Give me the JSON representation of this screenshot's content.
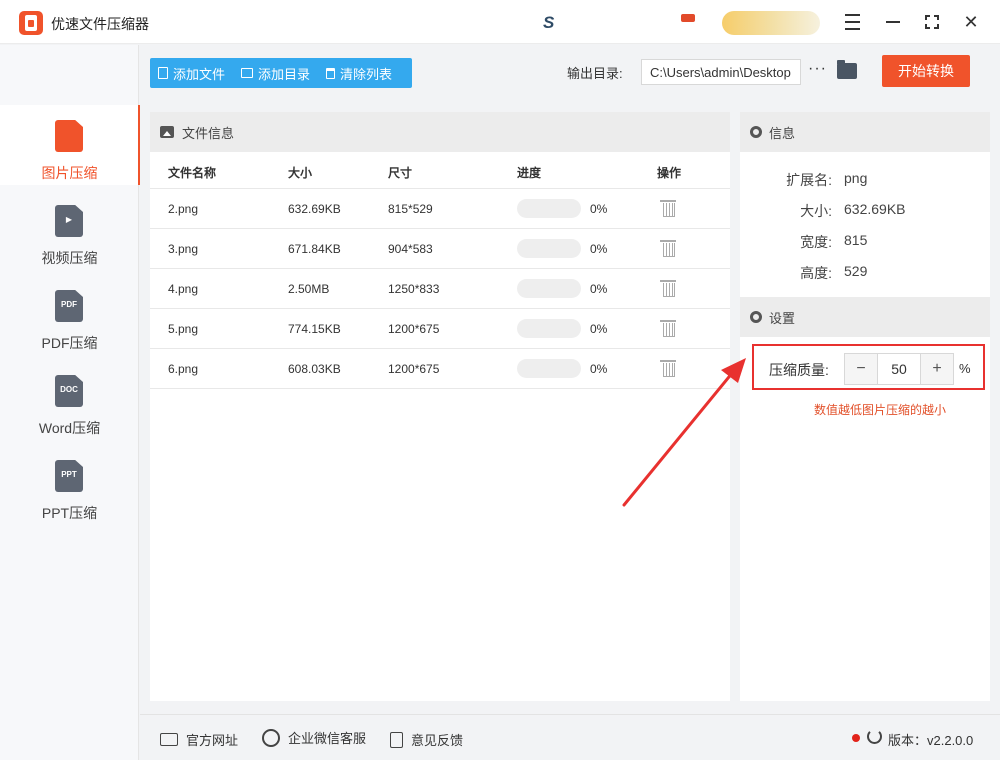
{
  "app": {
    "title": "优速文件压缩器"
  },
  "colors": {
    "accent": "#f0532b",
    "toolbar_blue": "#34a9ee",
    "hint_red": "#e2502a",
    "annotation_red": "#e8312f"
  },
  "sidebar": {
    "items": [
      {
        "label": "图片压缩",
        "icon": "image-file-icon",
        "icon_text": "",
        "active": true
      },
      {
        "label": "视频压缩",
        "icon": "video-file-icon",
        "icon_text": "▶",
        "active": false
      },
      {
        "label": "PDF压缩",
        "icon": "pdf-file-icon",
        "icon_text": "PDF",
        "active": false
      },
      {
        "label": "Word压缩",
        "icon": "doc-file-icon",
        "icon_text": "DOC",
        "active": false
      },
      {
        "label": "PPT压缩",
        "icon": "ppt-file-icon",
        "icon_text": "PPT",
        "active": false
      }
    ]
  },
  "toolbar": {
    "add_file": "添加文件",
    "add_dir": "添加目录",
    "clear_list": "清除列表",
    "output_label": "输出目录:",
    "output_path": "C:\\Users\\admin\\Desktop",
    "more": "···",
    "start": "开始转换"
  },
  "file_panel": {
    "title": "文件信息",
    "columns": {
      "name": "文件名称",
      "size": "大小",
      "dims": "尺寸",
      "progress": "进度",
      "action": "操作"
    },
    "rows": [
      {
        "name": "2.png",
        "size": "632.69KB",
        "dims": "815*529",
        "progress": 0,
        "percent": "0%"
      },
      {
        "name": "3.png",
        "size": "671.84KB",
        "dims": "904*583",
        "progress": 0,
        "percent": "0%"
      },
      {
        "name": "4.png",
        "size": "2.50MB",
        "dims": "1250*833",
        "progress": 0,
        "percent": "0%"
      },
      {
        "name": "5.png",
        "size": "774.15KB",
        "dims": "1200*675",
        "progress": 0,
        "percent": "0%"
      },
      {
        "name": "6.png",
        "size": "608.03KB",
        "dims": "1200*675",
        "progress": 0,
        "percent": "0%"
      }
    ]
  },
  "info_panel": {
    "title": "信息",
    "ext_key": "扩展名:",
    "ext_val": "png",
    "size_key": "大小:",
    "size_val": "632.69KB",
    "width_key": "宽度:",
    "width_val": "815",
    "height_key": "高度:",
    "height_val": "529"
  },
  "settings": {
    "title": "设置",
    "quality_label": "压缩质量:",
    "quality_value": "50",
    "minus": "−",
    "plus": "+",
    "percent_sign": "%",
    "hint": "数值越低图片压缩的越小"
  },
  "footer": {
    "website": "官方网址",
    "wechat": "企业微信客服",
    "feedback": "意见反馈",
    "version": "版本：v2.2.0.0"
  }
}
